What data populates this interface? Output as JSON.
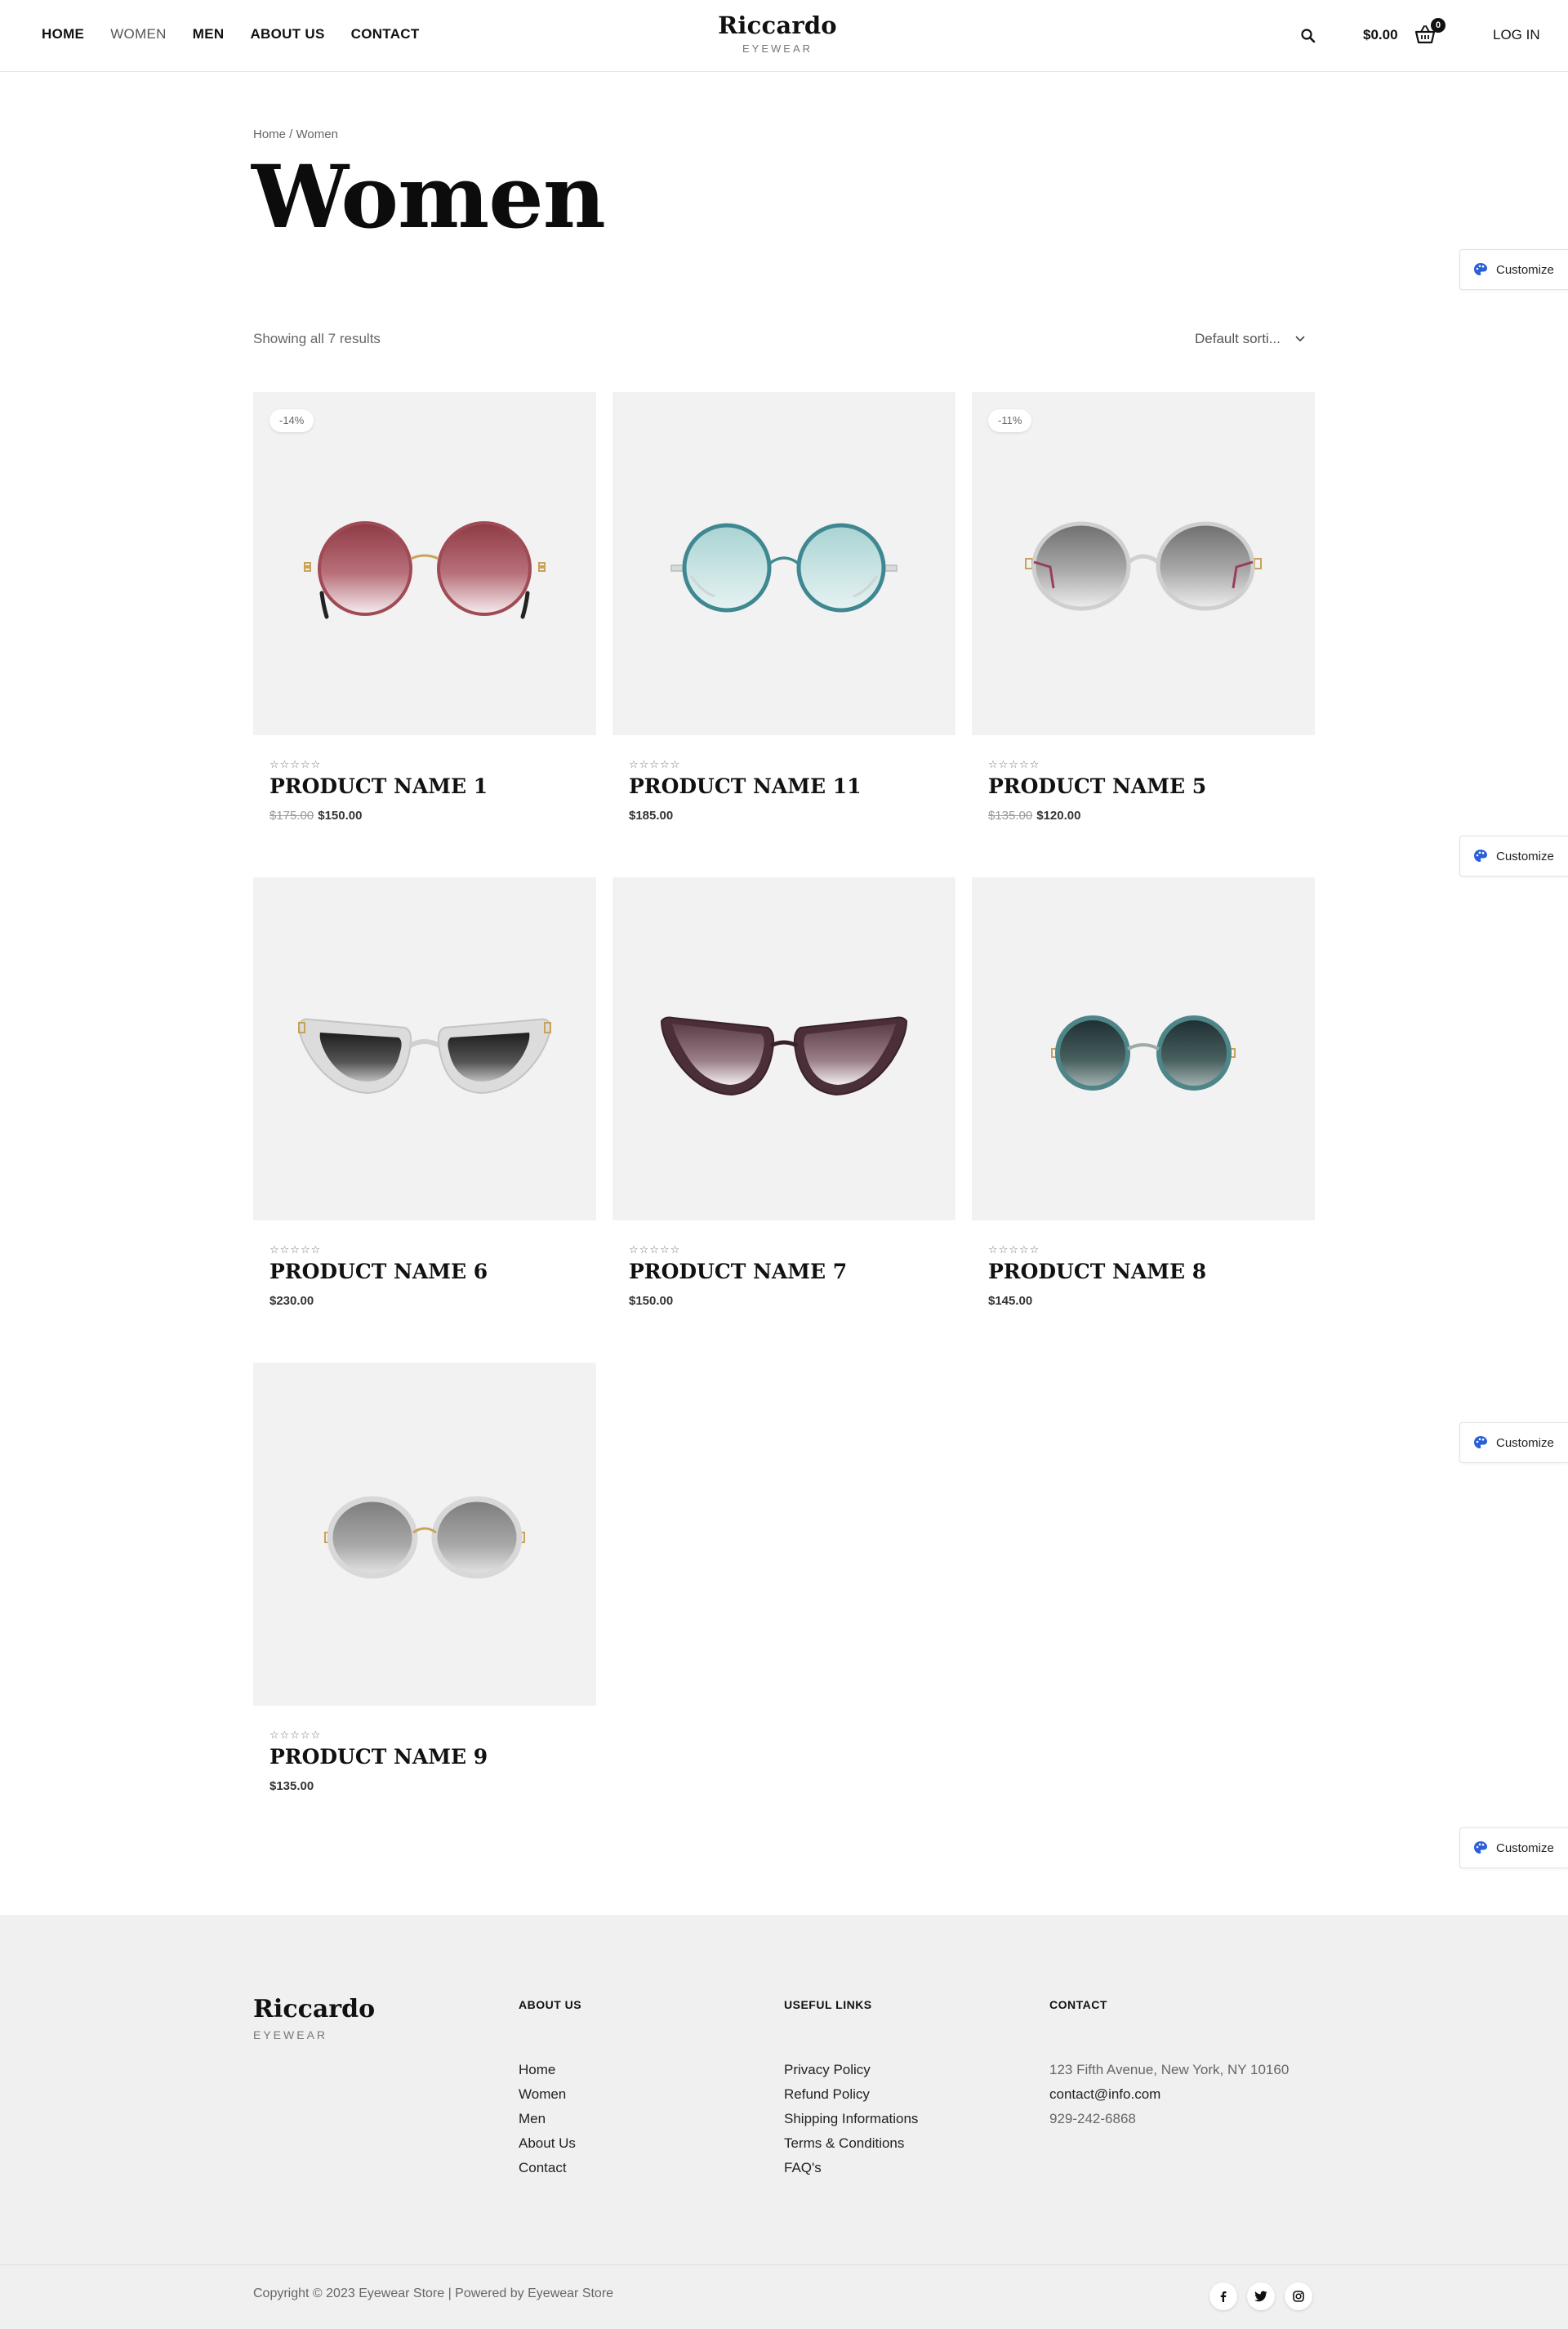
{
  "header": {
    "nav": [
      "HOME",
      "WOMEN",
      "MEN",
      "ABOUT US",
      "CONTACT"
    ],
    "brand": "Riccardo",
    "brand_sub": "EYEWEAR",
    "cart_total": "$0.00",
    "cart_count": "0",
    "login": "LOG IN"
  },
  "breadcrumb": "Home / Women",
  "page_title": "Women",
  "results_text": "Showing all 7 results",
  "sort_label": "Default sorti...",
  "customize_label": "Customize",
  "stars": "☆☆☆☆☆",
  "products": [
    {
      "name": "PRODUCT NAME 1",
      "old_price": "$175.00",
      "price": "$150.00",
      "badge": "-14%"
    },
    {
      "name": "PRODUCT NAME 11",
      "old_price": "",
      "price": "$185.00",
      "badge": ""
    },
    {
      "name": "PRODUCT NAME 5",
      "old_price": "$135.00",
      "price": "$120.00",
      "badge": "-11%"
    },
    {
      "name": "PRODUCT NAME 6",
      "old_price": "",
      "price": "$230.00",
      "badge": ""
    },
    {
      "name": "PRODUCT NAME 7",
      "old_price": "",
      "price": "$150.00",
      "badge": ""
    },
    {
      "name": "PRODUCT NAME 8",
      "old_price": "",
      "price": "$145.00",
      "badge": ""
    },
    {
      "name": "PRODUCT NAME 9",
      "old_price": "",
      "price": "$135.00",
      "badge": ""
    }
  ],
  "footer": {
    "brand": "Riccardo",
    "brand_sub": "EYEWEAR",
    "about": {
      "title": "ABOUT US",
      "links": [
        "Home",
        "Women",
        "Men",
        "About Us",
        "Contact"
      ]
    },
    "useful": {
      "title": "USEFUL LINKS",
      "links": [
        "Privacy Policy",
        "Refund Policy",
        "Shipping Informations",
        "Terms & Conditions",
        "FAQ's"
      ]
    },
    "contact": {
      "title": "CONTACT",
      "address": "123 Fifth Avenue, New York, NY 10160",
      "email": "contact@info.com",
      "phone": "929-242-6868"
    },
    "copyright": "Copyright © 2023 Eyewear Store | Powered by Eyewear Store"
  },
  "icons": {
    "search": "search-icon",
    "cart": "basket-icon",
    "customize": "palette-icon",
    "sort": "chevron-down-icon",
    "social": [
      "facebook-icon",
      "twitter-icon",
      "instagram-icon"
    ]
  },
  "colors": {
    "background": "#ffffff",
    "product_bg": "#f1f2f1",
    "footer_bg": "#f0f0f0",
    "text": "#111111",
    "muted": "#666666",
    "accent_blue": "#2b5fd9"
  }
}
